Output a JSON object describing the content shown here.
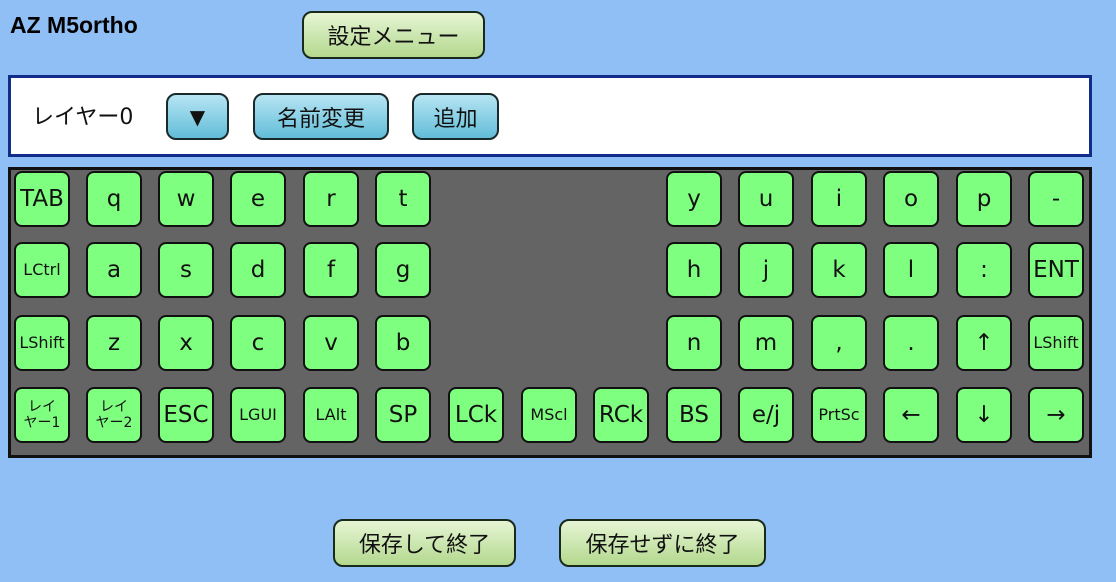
{
  "app": {
    "title": "AZ M5ortho",
    "settings_button": "設定メニュー"
  },
  "layer_bar": {
    "current_layer": "レイヤー0",
    "dropdown_label": "▼",
    "rename_button": "名前変更",
    "add_button": "追加"
  },
  "keyboard": {
    "rows": [
      [
        "TAB",
        "q",
        "w",
        "e",
        "r",
        "t",
        "y",
        "u",
        "i",
        "o",
        "p",
        "-"
      ],
      [
        "LCtrl",
        "a",
        "s",
        "d",
        "f",
        "g",
        "h",
        "j",
        "k",
        "l",
        ":",
        "ENT"
      ],
      [
        "LShift",
        "z",
        "x",
        "c",
        "v",
        "b",
        "n",
        "m",
        ",",
        ".",
        "↑",
        "LShift"
      ],
      [
        "レイ\nヤー1",
        "レイ\nヤー2",
        "ESC",
        "LGUI",
        "LAlt",
        "SP",
        "LCk",
        "MScl",
        "RCk",
        "BS",
        "e/j",
        "PrtSc",
        "←",
        "↓",
        "→"
      ]
    ]
  },
  "footer": {
    "save_exit_button": "保存して終了",
    "exit_without_save_button": "保存せずに終了"
  },
  "colors": {
    "background": "#8fbff5",
    "key_fill": "#7fff7f",
    "keyboard_panel": "#646464",
    "layer_bar_border": "#102d8c"
  }
}
